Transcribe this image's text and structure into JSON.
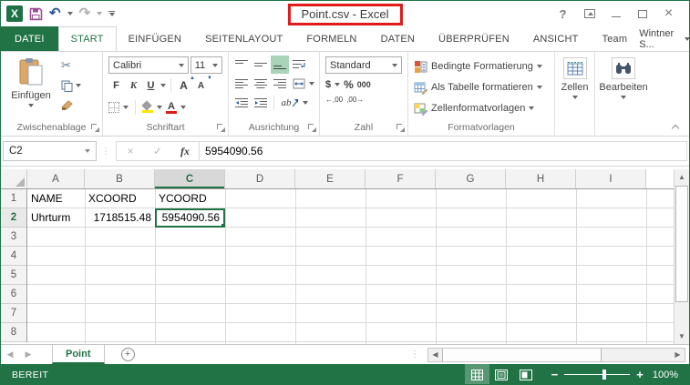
{
  "titlebar": {
    "title": "Point.csv - Excel",
    "help": "?"
  },
  "tabs": {
    "file": "DATEI",
    "items": [
      "START",
      "EINFÜGEN",
      "SEITENLAYOUT",
      "FORMELN",
      "DATEN",
      "ÜBERPRÜFEN",
      "ANSICHT",
      "Team"
    ],
    "account": "Wintner S..."
  },
  "ribbon": {
    "paste": "Einfügen",
    "font_name": "Calibri",
    "font_size": "11",
    "bold": "F",
    "italic": "K",
    "underline": "U",
    "grow": "A",
    "shrink": "A",
    "orientation_text": "ab",
    "number_format": "Standard",
    "currency": "$",
    "percent": "%",
    "thousands": "000",
    "inc_decimal": "←,00",
    "dec_decimal": ",00→",
    "styles": [
      "Bedingte Formatierung",
      "Als Tabelle formatieren",
      "Zellenformatvorlagen"
    ],
    "cells": "Zellen",
    "editing": "Bearbeiten",
    "group_labels": {
      "clipboard": "Zwischenablage",
      "font": "Schriftart",
      "alignment": "Ausrichtung",
      "number": "Zahl",
      "styles": "Formatvorlagen"
    }
  },
  "formula": {
    "name_box": "C2",
    "fx": "fx",
    "value": "5954090.56"
  },
  "grid": {
    "col_headers": [
      "A",
      "B",
      "C",
      "D",
      "E",
      "F",
      "G",
      "H",
      "I"
    ],
    "row_headers": [
      "1",
      "2",
      "3",
      "4",
      "5",
      "6",
      "7",
      "8"
    ],
    "selected_cell": "C2",
    "cells": {
      "A1": "NAME",
      "B1": "XCOORD",
      "C1": "YCOORD",
      "A2": "Uhrturm",
      "B2": "1718515.48",
      "C2": "5954090.56"
    }
  },
  "sheet": {
    "tab": "Point"
  },
  "status": {
    "mode": "BEREIT",
    "zoom": "100%"
  },
  "colors": {
    "excel_green": "#217346",
    "annotation_red": "#e11a1a"
  }
}
